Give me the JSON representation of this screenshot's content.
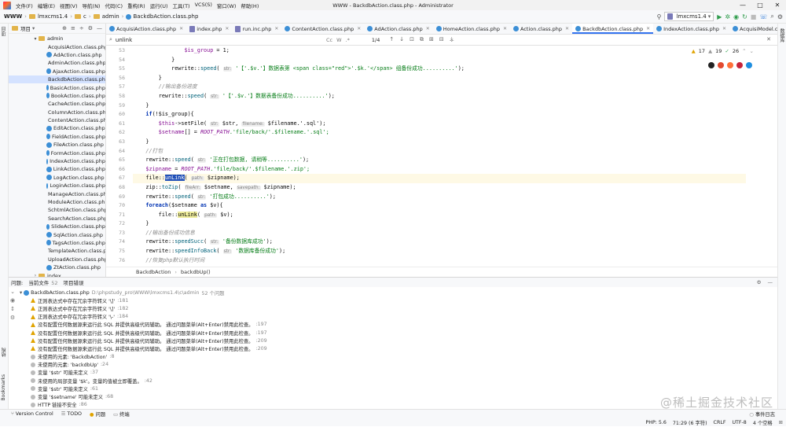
{
  "window": {
    "title": "WWW - BackdbAction.class.php - Administrator",
    "controls": [
      "—",
      "□",
      "✕"
    ]
  },
  "menu": [
    "文件(F)",
    "编辑(E)",
    "视图(V)",
    "导航(N)",
    "代码(C)",
    "重构(R)",
    "运行(U)",
    "工具(T)",
    "VCS(S)",
    "窗口(W)",
    "帮助(H)"
  ],
  "nav": {
    "project": "WWW",
    "crumbs": [
      "lmxcms1.4",
      "c",
      "admin",
      "BackdbAction.class.php"
    ],
    "run_config": "lmxcms1.4"
  },
  "project_panel": {
    "title": "项目",
    "root": "admin",
    "selected": "BackdbAction.class.php",
    "files": [
      "AcquisiAction.class.php",
      "AdAction.class.php",
      "AdminAction.class.php",
      "AjaxAction.class.php",
      "BackdbAction.class.php",
      "BasicAction.class.php",
      "BookAction.class.php",
      "CacheAction.class.php",
      "ColumnAction.class.php",
      "ContentAction.class.php",
      "EditAction.class.php",
      "FieldAction.class.php",
      "FileAction.class.php",
      "FormAction.class.php",
      "IndexAction.class.php",
      "LinkAction.class.php",
      "LogAction.class.php",
      "LoginAction.class.php",
      "ManageAction.class.php",
      "ModuleAction.class.php",
      "SchtmlAction.class.php",
      "SearchAction.class.php",
      "SlideAction.class.php",
      "SqlAction.class.php",
      "TagsAction.class.php",
      "TemplateAction.class.php",
      "UploadAction.class.php",
      "ZtAction.class.php",
      "index"
    ]
  },
  "tabs": [
    "AcquisiAction.class.php",
    "index.php",
    "run.inc.php",
    "ContentAction.class.php",
    "AdAction.class.php",
    "HomeAction.class.php",
    "Action.class.php",
    "BackdbAction.class.php",
    "IndexAction.class.php",
    "AcquisiModel.class.php"
  ],
  "active_tab": "BackdbAction.class.php",
  "search": {
    "query": "unlink",
    "options": [
      "Cc",
      "W",
      ".*"
    ],
    "count": "1/4"
  },
  "inspections": {
    "warnings": "17",
    "weak": "19",
    "typos": "26"
  },
  "breadcrumb": [
    "BackdbAction",
    "backdbUp()"
  ],
  "line_numbers": [
    "53",
    "54",
    "55",
    "56",
    "57",
    "58",
    "59",
    "60",
    "61",
    "62",
    "63",
    "64",
    "65",
    "66",
    "67",
    "68",
    "69",
    "70",
    "71",
    "72",
    "73",
    "74",
    "75",
    "76"
  ],
  "code": {
    "l53_var": "$is_group",
    "l53_rest": " = 1;",
    "l54": "}",
    "l55_fn": "speed",
    "l55_hint": "str:",
    "l55_a": " '【'.$v.'】数据表第 <span class=\"red\">'.$k.'</span> 组备份成功..........'",
    "l56": "}",
    "l57": "//输出备份进度",
    "l58_hint": "str:",
    "l58_a": " '【'.$v.'】数据表备份成功..........'",
    "l59_b": "}",
    "l60_a": "if",
    "l60_b": "(!$is_group){",
    "l61_a": "$this",
    "l61_b": "->setFile(",
    "l61_h1": "str:",
    "l61_c": " $str,",
    "l61_h2": "filename:",
    "l61_d": " $filename.'.sql');",
    "l62_a": "$setname",
    "l62_b": "[] = ",
    "l62_c": "ROOT_PATH",
    "l62_d": ".'file/back/'.$filename.'.sql';",
    "l63": "}",
    "l64": "//打包",
    "l65_hint": "str:",
    "l65_a": " '正在打包数据, 请稍等..........'",
    "l66_a": "$zipname",
    "l66_b": " = ",
    "l66_c": "ROOT_PATH",
    "l66_d": ".'file/back/'.$filename.'.zip';",
    "l67_a": "file::",
    "l67_b": "unLink",
    "l67_hint": "path:",
    "l67_c": " $zipname);",
    "l68_a": "zip::",
    "l68_b": "toZip",
    "l68_h1": "fileArr:",
    "l68_c": " $setname,",
    "l68_h2": "savepath:",
    "l68_d": " $zipname);",
    "l69_hint": "str:",
    "l69_a": " '打包成功..........'",
    "l70_a": "foreach",
    "l70_b": "($setname ",
    "l70_c": "as",
    "l70_d": " $v){",
    "l71_a": "file::",
    "l71_b": "unLink",
    "l71_hint": "path:",
    "l71_c": " $v);",
    "l72": "}",
    "l73": "//输出备份成功信息",
    "l74_fn": "speedSucc",
    "l74_hint": "str:",
    "l74_a": " '备份数据库成功'",
    "l75_fn": "speedInfoBack",
    "l75_hint": "str:",
    "l75_a": " '数据库备份成功'",
    "l76": "//恢复php默认执行时间",
    "rewrite": "rewrite::"
  },
  "problems": {
    "tabs": [
      {
        "label": "问题",
        "count": ""
      },
      {
        "label": "当前文件",
        "count": "52"
      },
      {
        "label": "项目错误",
        "count": ""
      }
    ],
    "file": "BackdbAction.class.php",
    "path": "D:\\phpstudy_pro\\WWW\\lmxcms1.4\\c\\admin",
    "summary": "52 个问题",
    "items": [
      {
        "text": "正则表达式中存在冗余字符转义 '\\]'",
        "loc": ":181",
        "kind": "warn"
      },
      {
        "text": "正则表达式中存在冗余字符转义 '\\]'",
        "loc": ":182",
        "kind": "warn"
      },
      {
        "text": "正则表达式中存在冗余字符转义 '\\-'",
        "loc": ":184",
        "kind": "warn"
      },
      {
        "text": "没有配置任何数据源来运行此 SQL 并提供高级代码辅助。 通过问题菜单(Alt+Enter)禁用此检查。",
        "loc": ":197",
        "kind": "warn"
      },
      {
        "text": "没有配置任何数据源来运行此 SQL 并提供高级代码辅助。 通过问题菜单(Alt+Enter)禁用此检查。",
        "loc": ":197",
        "kind": "warn"
      },
      {
        "text": "没有配置任何数据源来运行此 SQL 并提供高级代码辅助。 通过问题菜单(Alt+Enter)禁用此检查。",
        "loc": ":209",
        "kind": "warn"
      },
      {
        "text": "没有配置任何数据源来运行此 SQL 并提供高级代码辅助。 通过问题菜单(Alt+Enter)禁用此检查。",
        "loc": ":209",
        "kind": "warn"
      },
      {
        "text": "未使用的元素: 'BackdbAction'",
        "loc": ":8",
        "kind": "weak"
      },
      {
        "text": "未使用的元素: 'backdbUp'",
        "loc": ":24",
        "kind": "weak"
      },
      {
        "text": "变量 '$str' 可能未定义",
        "loc": ":37",
        "kind": "weak"
      },
      {
        "text": "未使用的局部变量 '$k'。变量的值被立即覆盖。",
        "loc": ":42",
        "kind": "weak"
      },
      {
        "text": "变量 '$str' 可能未定义",
        "loc": ":61",
        "kind": "weak"
      },
      {
        "text": "变量 '$setname' 可能未定义",
        "loc": ":68",
        "kind": "weak"
      },
      {
        "text": "HTTP 链接不安全",
        "loc": ":86",
        "kind": "weak"
      }
    ]
  },
  "status": {
    "tabs": [
      "Version Control",
      "TODO",
      "问题",
      "终端"
    ],
    "event_log": "事件日志",
    "php": "PHP: 5.6",
    "position": "71:29 (6 字符)",
    "line_sep": "CRLF",
    "encoding": "UTF-8",
    "indent": "4 个空格"
  },
  "left_strip": [
    "项目",
    "结构",
    "Bookmarks"
  ],
  "right_strip": [
    "数据库"
  ],
  "watermark": "@稀土掘金技术社区"
}
